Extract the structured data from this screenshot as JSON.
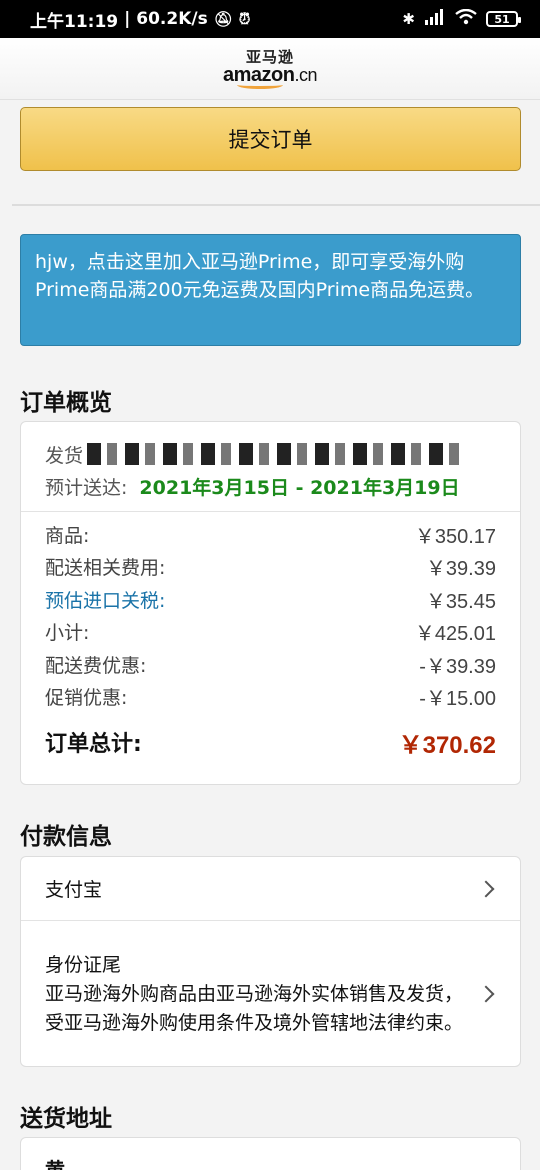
{
  "status_bar": {
    "time": "上午11:19",
    "speed": "| 60.2K/s",
    "battery": "51"
  },
  "header": {
    "logo_cn": "亚马逊",
    "logo_en": "amazon",
    "logo_suffix": ".cn"
  },
  "submit_button": "提交订单",
  "prime_banner": "hjw，点击这里加入亚马逊Prime，即可享受海外购Prime商品满200元免运费及国内Prime商品免运费。",
  "order_overview": {
    "title": "订单概览",
    "ship_label": "发货",
    "eta_label": "预计送达:",
    "eta_value": "2021年3月15日 - 2021年3月19日",
    "rows": [
      {
        "label": "商品:",
        "value": "￥350.17"
      },
      {
        "label": "配送相关费用:",
        "value": "￥39.39"
      },
      {
        "label": "预估进口关税:",
        "value": "￥35.45"
      },
      {
        "label": "小计:",
        "value": "￥425.01"
      },
      {
        "label": "配送费优惠:",
        "value": "-￥39.39"
      },
      {
        "label": "促销优惠:",
        "value": "-￥15.00"
      }
    ],
    "total_label": "订单总计:",
    "total_value": "￥370.62"
  },
  "payment": {
    "title": "付款信息",
    "method": "支付宝",
    "id_label": "身份证尾",
    "notice": "亚马逊海外购商品由亚马逊海外实体销售及发货，受亚马逊海外购使用条件及境外管辖地法律约束。"
  },
  "shipping": {
    "title": "送货地址",
    "name": "黄"
  }
}
